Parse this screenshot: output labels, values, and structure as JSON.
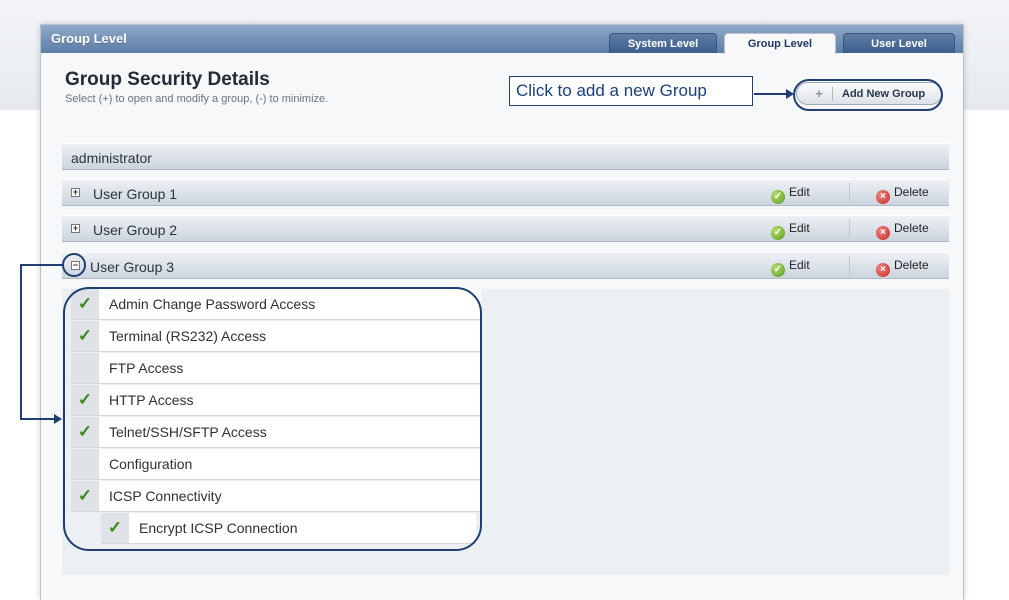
{
  "panel": {
    "title": "Group Level"
  },
  "tabs": [
    {
      "label": "System Level",
      "active": false
    },
    {
      "label": "Group Level",
      "active": true
    },
    {
      "label": "User Level",
      "active": false
    }
  ],
  "header": {
    "title": "Group Security Details",
    "subtitle": "Select (+) to open and modify a group, (-) to minimize."
  },
  "callout": {
    "text": "Click to add a new Group"
  },
  "add_button": {
    "icon": "+",
    "label": "Add New Group"
  },
  "groups": [
    {
      "name": "administrator"
    },
    {
      "name": "User Group 1",
      "expanded": false,
      "edit": "Edit",
      "delete": "Delete"
    },
    {
      "name": "User Group 2",
      "expanded": false,
      "edit": "Edit",
      "delete": "Delete"
    },
    {
      "name": "User Group 3",
      "expanded": true,
      "edit": "Edit",
      "delete": "Delete"
    }
  ],
  "expand_icons": {
    "collapsed": "+",
    "expanded": "−"
  },
  "permissions": [
    {
      "label": "Admin Change Password Access",
      "checked": true
    },
    {
      "label": "Terminal (RS232) Access",
      "checked": true
    },
    {
      "label": "FTP Access",
      "checked": false
    },
    {
      "label": "HTTP Access",
      "checked": true
    },
    {
      "label": "Telnet/SSH/SFTP Access",
      "checked": true
    },
    {
      "label": "Configuration",
      "checked": false
    },
    {
      "label": "ICSP Connectivity",
      "checked": true
    },
    {
      "label": "Encrypt ICSP Connection",
      "checked": true,
      "sub": true
    }
  ],
  "check_glyph": "✓",
  "colors": {
    "accent": "#1f3f73",
    "check": "#3b8a18",
    "edit": "#55961b",
    "delete": "#c5261f"
  }
}
